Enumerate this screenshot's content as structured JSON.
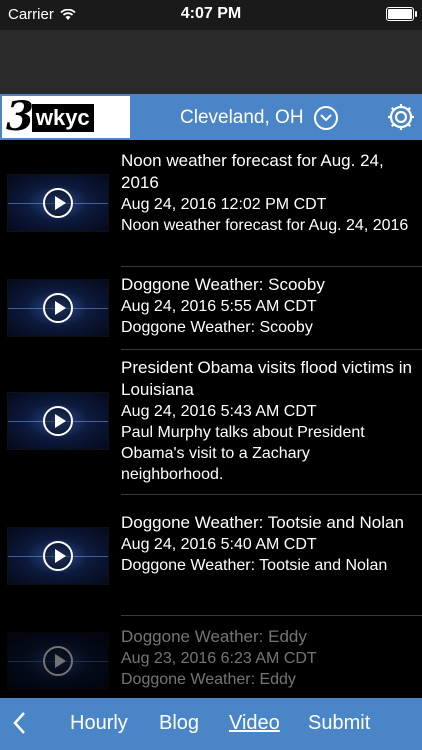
{
  "status_bar": {
    "carrier": "Carrier",
    "time": "4:07 PM",
    "wifi_icon": "wifi-icon",
    "battery_icon": "battery-icon"
  },
  "header": {
    "logo_number": "3",
    "logo_word": "wkyc",
    "location": "Cleveland, OH",
    "location_icon": "chevron-down-circle-icon",
    "settings_icon": "gear-icon",
    "colors": {
      "nav": "#4a86c7"
    }
  },
  "videos": [
    {
      "title": "Noon weather forecast for Aug. 24, 2016",
      "date": "Aug 24, 2016 12:02 PM CDT",
      "description": "Noon weather forecast for Aug. 24, 2016"
    },
    {
      "title": "Doggone Weather: Scooby",
      "date": "Aug 24, 2016 5:55 AM CDT",
      "description": "Doggone Weather: Scooby"
    },
    {
      "title": "President Obama visits flood victims in Louisiana",
      "date": "Aug 24, 2016 5:43 AM CDT",
      "description": "Paul Murphy talks about President Obama's visit to a Zachary neighborhood."
    },
    {
      "title": "Doggone Weather: Tootsie and Nolan",
      "date": "Aug 24, 2016 5:40 AM CDT",
      "description": "Doggone Weather: Tootsie and Nolan"
    },
    {
      "title": "Doggone Weather: Eddy",
      "date": "Aug 23, 2016 6:23 AM CDT",
      "description": "Doggone Weather: Eddy"
    }
  ],
  "tabs": [
    {
      "label": "Hourly",
      "active": false
    },
    {
      "label": "Blog",
      "active": false
    },
    {
      "label": "Video",
      "active": true
    },
    {
      "label": "Submit",
      "active": false
    }
  ],
  "back_icon": "chevron-left-icon"
}
